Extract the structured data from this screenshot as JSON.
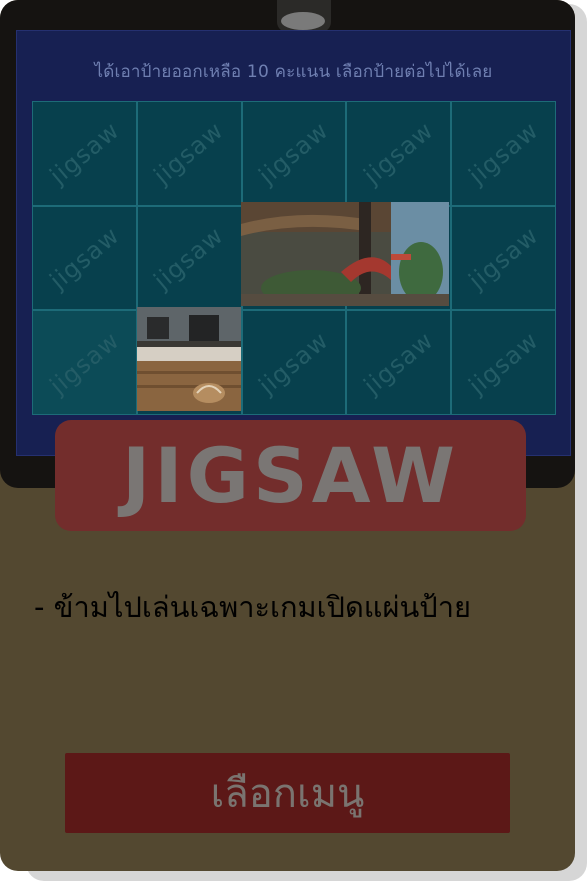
{
  "game": {
    "header": "ได้เอาป้ายออกเหลือ 10 คะแนน เลือกป้ายต่อไปได้เลย",
    "tile_watermark": "jigsaw",
    "tiles": [
      {
        "state": "hidden"
      },
      {
        "state": "hidden"
      },
      {
        "state": "hidden"
      },
      {
        "state": "hidden"
      },
      {
        "state": "hidden"
      },
      {
        "state": "hidden"
      },
      {
        "state": "hidden"
      },
      {
        "state": "revealed"
      },
      {
        "state": "revealed"
      },
      {
        "state": "hidden"
      },
      {
        "state": "hidden"
      },
      {
        "state": "revealed"
      },
      {
        "state": "hidden"
      },
      {
        "state": "hidden"
      },
      {
        "state": "hidden"
      }
    ]
  },
  "category": {
    "label": "JIGSAW",
    "description": "- ข้ามไปเล่นเฉพาะเกมเปิดแผ่นป้าย"
  },
  "menu_button": {
    "label": "เลือกเมนู"
  },
  "colors": {
    "overlay": "#534830",
    "label_box": "#732d2c",
    "button": "#5c1817",
    "tile": "#07404d",
    "panel": "#172052"
  }
}
